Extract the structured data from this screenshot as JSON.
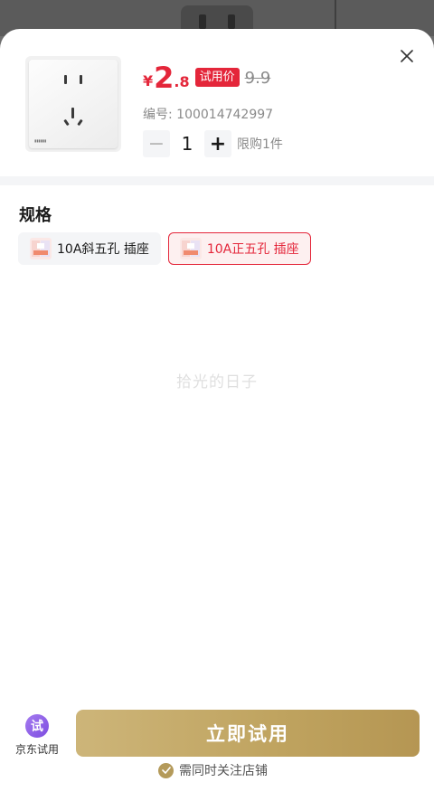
{
  "product": {
    "currency": "¥",
    "price_int": "2",
    "price_dec": ".8",
    "trial_badge": "试用价",
    "original_price": "9.9",
    "code_line": "编号: 100014742997"
  },
  "quantity": {
    "minus": "−",
    "value": "1",
    "plus": "+",
    "limit": "限购1件"
  },
  "spec": {
    "title": "规格",
    "options": [
      {
        "label": "10A斜五孔 插座",
        "selected": false
      },
      {
        "label": "10A正五孔 插座",
        "selected": true
      }
    ]
  },
  "watermark": "拾光的日子",
  "footer": {
    "jd_trial_icon": "试",
    "jd_trial_label": "京东试用",
    "cta_label": "立即试用",
    "follow_note": "需同时关注店铺"
  },
  "colors": {
    "price_red": "#e4263a",
    "gold": "#bfa35f",
    "purple": "#8a5ae6"
  },
  "icons": [
    "close-icon",
    "minus-icon",
    "plus-icon",
    "check-icon",
    "trial-icon"
  ]
}
